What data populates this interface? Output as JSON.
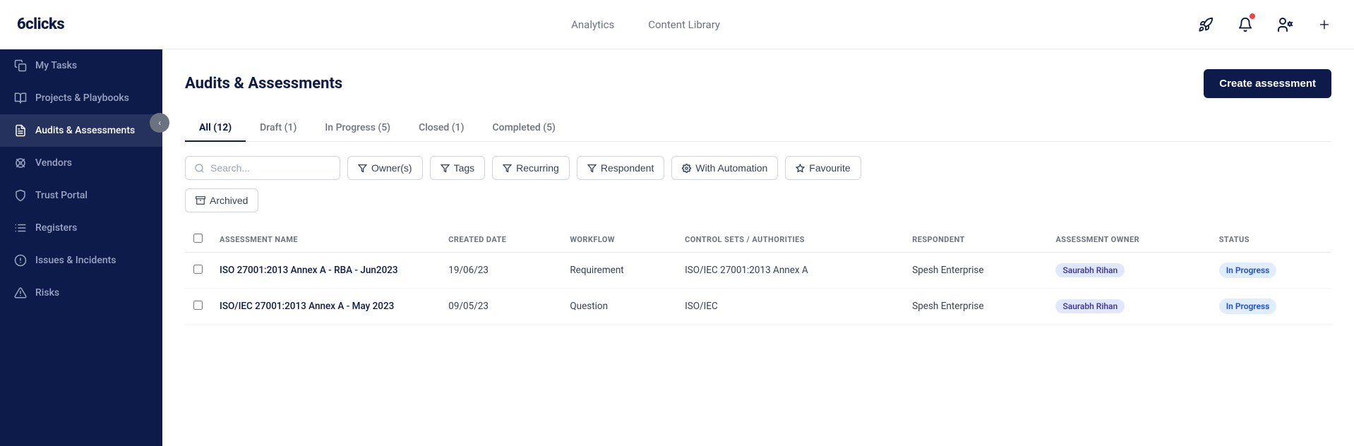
{
  "logo": "6clicks",
  "nav": {
    "links": [
      {
        "label": "Analytics",
        "id": "analytics"
      },
      {
        "label": "Content Library",
        "id": "content-library"
      }
    ],
    "icons": [
      {
        "name": "rocket-icon",
        "symbol": "🚀",
        "hasDot": false
      },
      {
        "name": "bell-icon",
        "symbol": "🔔",
        "hasDot": true
      },
      {
        "name": "user-settings-icon",
        "symbol": "👤",
        "hasDot": false
      },
      {
        "name": "plus-icon",
        "symbol": "+",
        "hasDot": false
      }
    ]
  },
  "sidebar": {
    "items": [
      {
        "id": "my-tasks",
        "label": "My Tasks",
        "icon": "tasks"
      },
      {
        "id": "projects-playbooks",
        "label": "Projects & Playbooks",
        "icon": "projects"
      },
      {
        "id": "audits-assessments",
        "label": "Audits & Assessments",
        "icon": "audits",
        "active": true
      },
      {
        "id": "vendors",
        "label": "Vendors",
        "icon": "vendors"
      },
      {
        "id": "trust-portal",
        "label": "Trust Portal",
        "icon": "trust"
      },
      {
        "id": "registers",
        "label": "Registers",
        "icon": "registers"
      },
      {
        "id": "issues-incidents",
        "label": "Issues & Incidents",
        "icon": "issues"
      },
      {
        "id": "risks",
        "label": "Risks",
        "icon": "risks"
      }
    ]
  },
  "page": {
    "title": "Audits & Assessments",
    "create_button": "Create assessment",
    "tabs": [
      {
        "label": "All (12)",
        "active": true
      },
      {
        "label": "Draft (1)",
        "active": false
      },
      {
        "label": "In Progress (5)",
        "active": false
      },
      {
        "label": "Closed (1)",
        "active": false
      },
      {
        "label": "Completed (5)",
        "active": false
      }
    ],
    "filters": {
      "search_placeholder": "Search...",
      "owner_label": "Owner(s)",
      "tags_label": "Tags",
      "recurring_label": "Recurring",
      "respondent_label": "Respondent",
      "with_automation_label": "With Automation",
      "favourite_label": "Favourite",
      "archived_label": "Archived"
    },
    "table": {
      "columns": [
        {
          "key": "checkbox",
          "label": ""
        },
        {
          "key": "assessment_name",
          "label": "Assessment Name"
        },
        {
          "key": "created_date",
          "label": "Created Date"
        },
        {
          "key": "workflow",
          "label": "Workflow"
        },
        {
          "key": "control_sets",
          "label": "Control Sets / Authorities"
        },
        {
          "key": "respondent",
          "label": "Respondent"
        },
        {
          "key": "assessment_owner",
          "label": "Assessment Owner"
        },
        {
          "key": "status",
          "label": "Status"
        }
      ],
      "rows": [
        {
          "id": 1,
          "assessment_name": "ISO 27001:2013 Annex A - RBA - Jun2023",
          "created_date": "19/06/23",
          "workflow": "Requirement",
          "control_sets": "ISO/IEC 27001:2013 Annex A",
          "respondent": "Spesh Enterprise",
          "assessment_owner": "Saurabh Rihan",
          "status": "In Progress"
        },
        {
          "id": 2,
          "assessment_name": "ISO/IEC 27001:2013 Annex A - May 2023",
          "created_date": "09/05/23",
          "workflow": "Question",
          "control_sets": "ISO/IEC",
          "respondent": "Spesh Enterprise",
          "assessment_owner": "Saurabh Rihan",
          "status": "In Progress"
        }
      ]
    }
  }
}
